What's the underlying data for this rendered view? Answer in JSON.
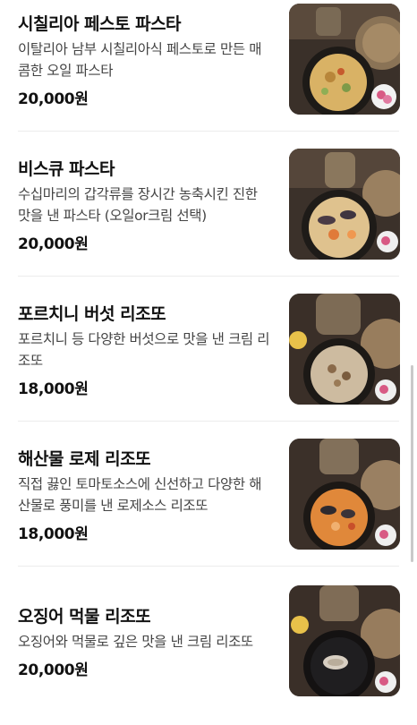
{
  "menu": {
    "items": [
      {
        "name": "시칠리아 페스토 파스타",
        "description": "이탈리아 남부 시칠리아식 페스토로 만든 매콤한 오일 파스타",
        "price": "20,000원"
      },
      {
        "name": "비스큐 파스타",
        "description": "수십마리의 갑각류를 장시간 농축시킨 진한 맛을 낸 파스타 (오일or크림 선택)",
        "price": "20,000원"
      },
      {
        "name": "포르치니 버섯 리조또",
        "description": "포르치니 등 다양한 버섯으로 맛을 낸 크림 리조또",
        "price": "18,000원"
      },
      {
        "name": "해산물 로제 리조또",
        "description": "직접 끓인 토마토소스에 신선하고 다양한 해산물로 풍미를 낸 로제소스 리조또",
        "price": "18,000원"
      },
      {
        "name": "오징어 먹물 리조또",
        "description": "오징어와 먹물로 깊은 맛을 낸 크림 리조또",
        "price": "20,000원"
      }
    ]
  },
  "colors": {
    "background": "#ffffff",
    "text_primary": "#111111",
    "text_secondary": "#444444",
    "divider": "#ececec"
  }
}
